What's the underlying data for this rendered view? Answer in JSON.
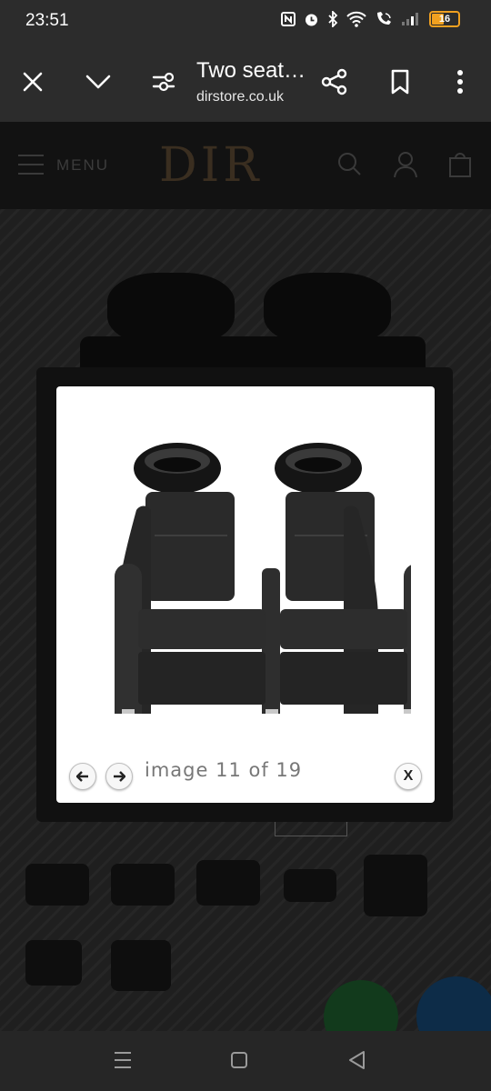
{
  "status_bar": {
    "time": "23:51",
    "battery": "16"
  },
  "toolbar": {
    "title": "Two seat…",
    "url": "dirstore.co.uk",
    "icons": [
      "close-icon",
      "chevron-down-icon",
      "page-settings-icon",
      "share-icon",
      "bookmark-icon",
      "more-vert-icon"
    ]
  },
  "site_header": {
    "menu_label": "MENU",
    "logo": "DIR",
    "icons": [
      "search-icon",
      "account-icon",
      "cart-icon"
    ]
  },
  "lightbox": {
    "counter": "image 11 of 19",
    "close_label": "X",
    "icons": [
      "arrow-left-icon",
      "arrow-right-icon",
      "close-icon"
    ]
  },
  "system_nav": {
    "icons": [
      "recents-icon",
      "home-icon",
      "back-icon"
    ]
  }
}
